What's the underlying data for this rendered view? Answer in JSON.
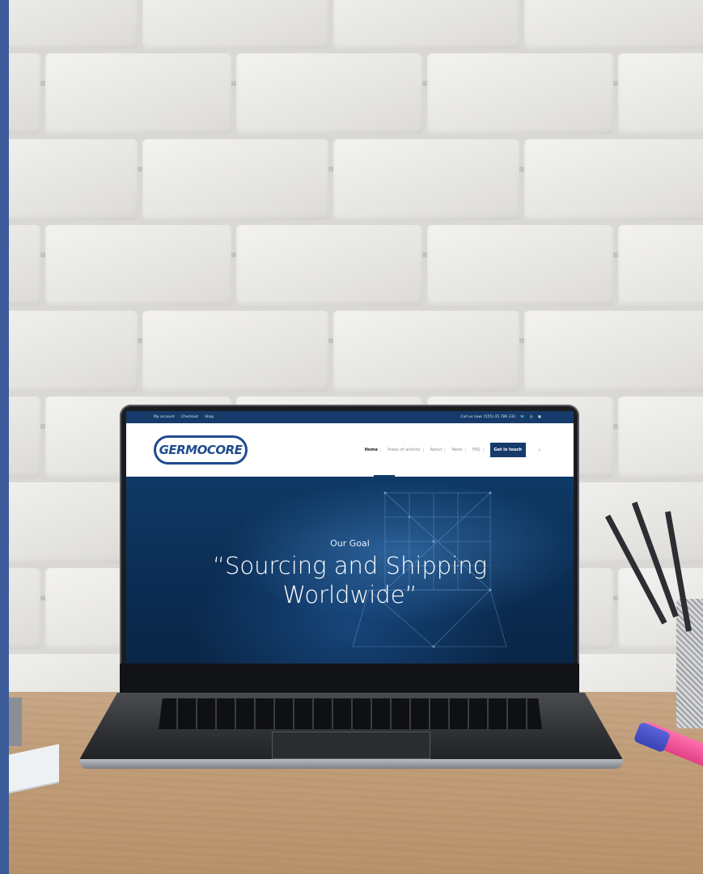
{
  "website": {
    "topbar": {
      "links": [
        "My account",
        "Checkout",
        "Shop"
      ],
      "phone_text": "Call us now: (555) 45 786 332",
      "social_icons": [
        "twitter-icon",
        "dribbble-icon",
        "instagram-icon"
      ]
    },
    "logo_text": "GERMOCORE",
    "menu": {
      "items": [
        "Home",
        "Areas of activity",
        "About",
        "News",
        "FAQ"
      ],
      "active_item": "Home",
      "cta_label": "Get in touch",
      "search_icon": "search-icon"
    },
    "hero": {
      "kicker": "Our Goal",
      "title": "“Sourcing and Shipping Worldwide”"
    }
  },
  "colors": {
    "accent_blue": "#163b6a",
    "logo_blue": "#1f4c8f",
    "left_bar": "#3b5b98"
  }
}
